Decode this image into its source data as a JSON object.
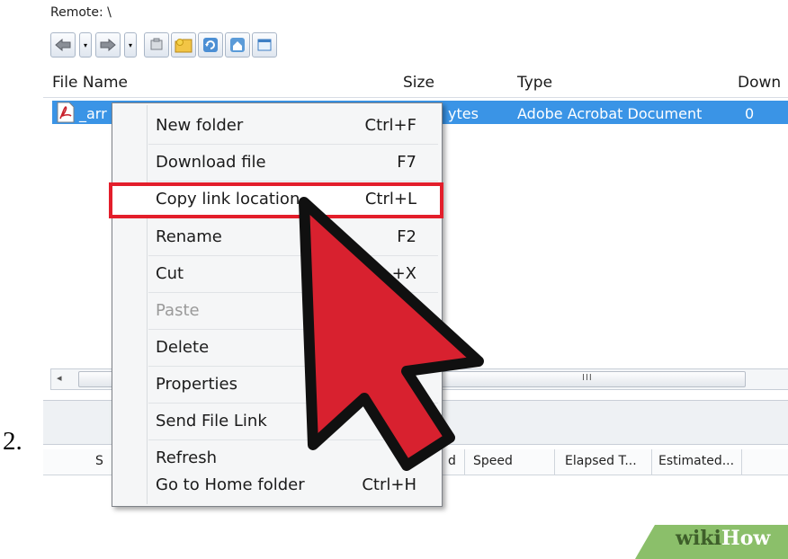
{
  "step_number": "2.",
  "remote": {
    "label": "Remote: \\"
  },
  "toolbar": {
    "icons": [
      "back-icon",
      "dropdown-icon",
      "forward-icon",
      "dropdown-icon",
      "tag-icon",
      "new-folder-icon",
      "refresh-icon",
      "home-icon",
      "window-icon"
    ]
  },
  "file_list": {
    "columns": [
      "File Name",
      "Size",
      "Type",
      "Down"
    ],
    "rows": [
      {
        "name": "_arr",
        "size": "ytes",
        "type": "Adobe Acrobat Document",
        "downloads": "0"
      }
    ]
  },
  "scrollbar": {
    "thumb_label": "III"
  },
  "queue": {
    "columns": [
      "S",
      "d",
      "Speed",
      "Elapsed T...",
      "Estimated..."
    ]
  },
  "context_menu": {
    "items": [
      {
        "label": "New folder",
        "shortcut": "Ctrl+F",
        "disabled": false
      },
      {
        "label": "Download file",
        "shortcut": "F7",
        "disabled": false
      },
      {
        "label": "Copy link location",
        "shortcut": "Ctrl+L",
        "disabled": false,
        "highlighted": true
      },
      {
        "label": "Rename",
        "shortcut": "F2",
        "disabled": false
      },
      {
        "label": "Cut",
        "shortcut": "+X",
        "disabled": false
      },
      {
        "label": "Paste",
        "shortcut": "",
        "disabled": true
      },
      {
        "label": "Delete",
        "shortcut": "",
        "disabled": false
      },
      {
        "label": "Properties",
        "shortcut": "",
        "disabled": false
      },
      {
        "label": "Send File Link",
        "shortcut": "C",
        "disabled": false
      },
      {
        "label": "Refresh",
        "shortcut": "",
        "disabled": false
      },
      {
        "label": "Go to Home folder",
        "shortcut": "Ctrl+H",
        "disabled": false
      }
    ]
  },
  "colors": {
    "selection": "#3a94e6",
    "highlight_border": "#e31e2b",
    "arrow": "#d8212f",
    "watermark_bg": "#8bbf6a"
  },
  "watermark": {
    "prefix": "wiki",
    "suffix": "How"
  }
}
